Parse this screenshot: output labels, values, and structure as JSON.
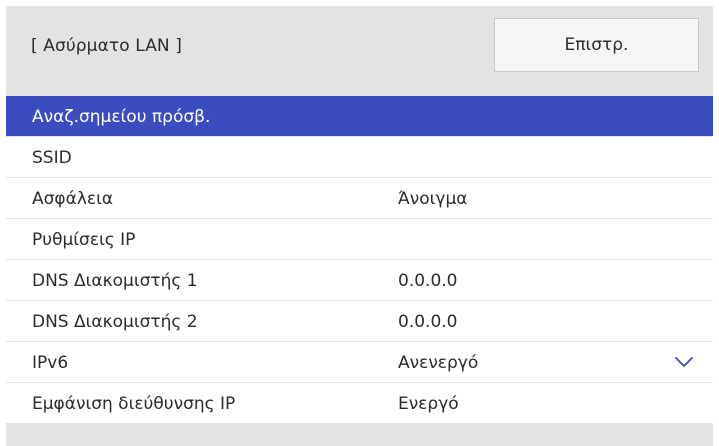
{
  "header": {
    "title": "[ Ασύρματο LAN ]",
    "back_label": "Επιστρ."
  },
  "rows": [
    {
      "label": "Αναζ.σημείου πρόσβ.",
      "value": "",
      "selected": true
    },
    {
      "label": "SSID",
      "value": ""
    },
    {
      "label": "Ασφάλεια",
      "value": "Άνοιγμα"
    },
    {
      "label": "Ρυθμίσεις IP",
      "value": ""
    },
    {
      "label": "DNS Διακομιστής 1",
      "value": "0.0.0.0"
    },
    {
      "label": "DNS Διακομιστής 2",
      "value": "0.0.0.0"
    },
    {
      "label": "IPv6",
      "value": "Ανενεργό",
      "icon": "chevron-down-icon"
    },
    {
      "label": "Εμφάνιση διεύθυνσης IP",
      "value": "Ενεργό"
    }
  ],
  "colors": {
    "selected_row": "#3b4cc0",
    "panel_background": "#e3e3e3",
    "row_background": "#ffffff",
    "chevron": "#3b4cc0"
  }
}
